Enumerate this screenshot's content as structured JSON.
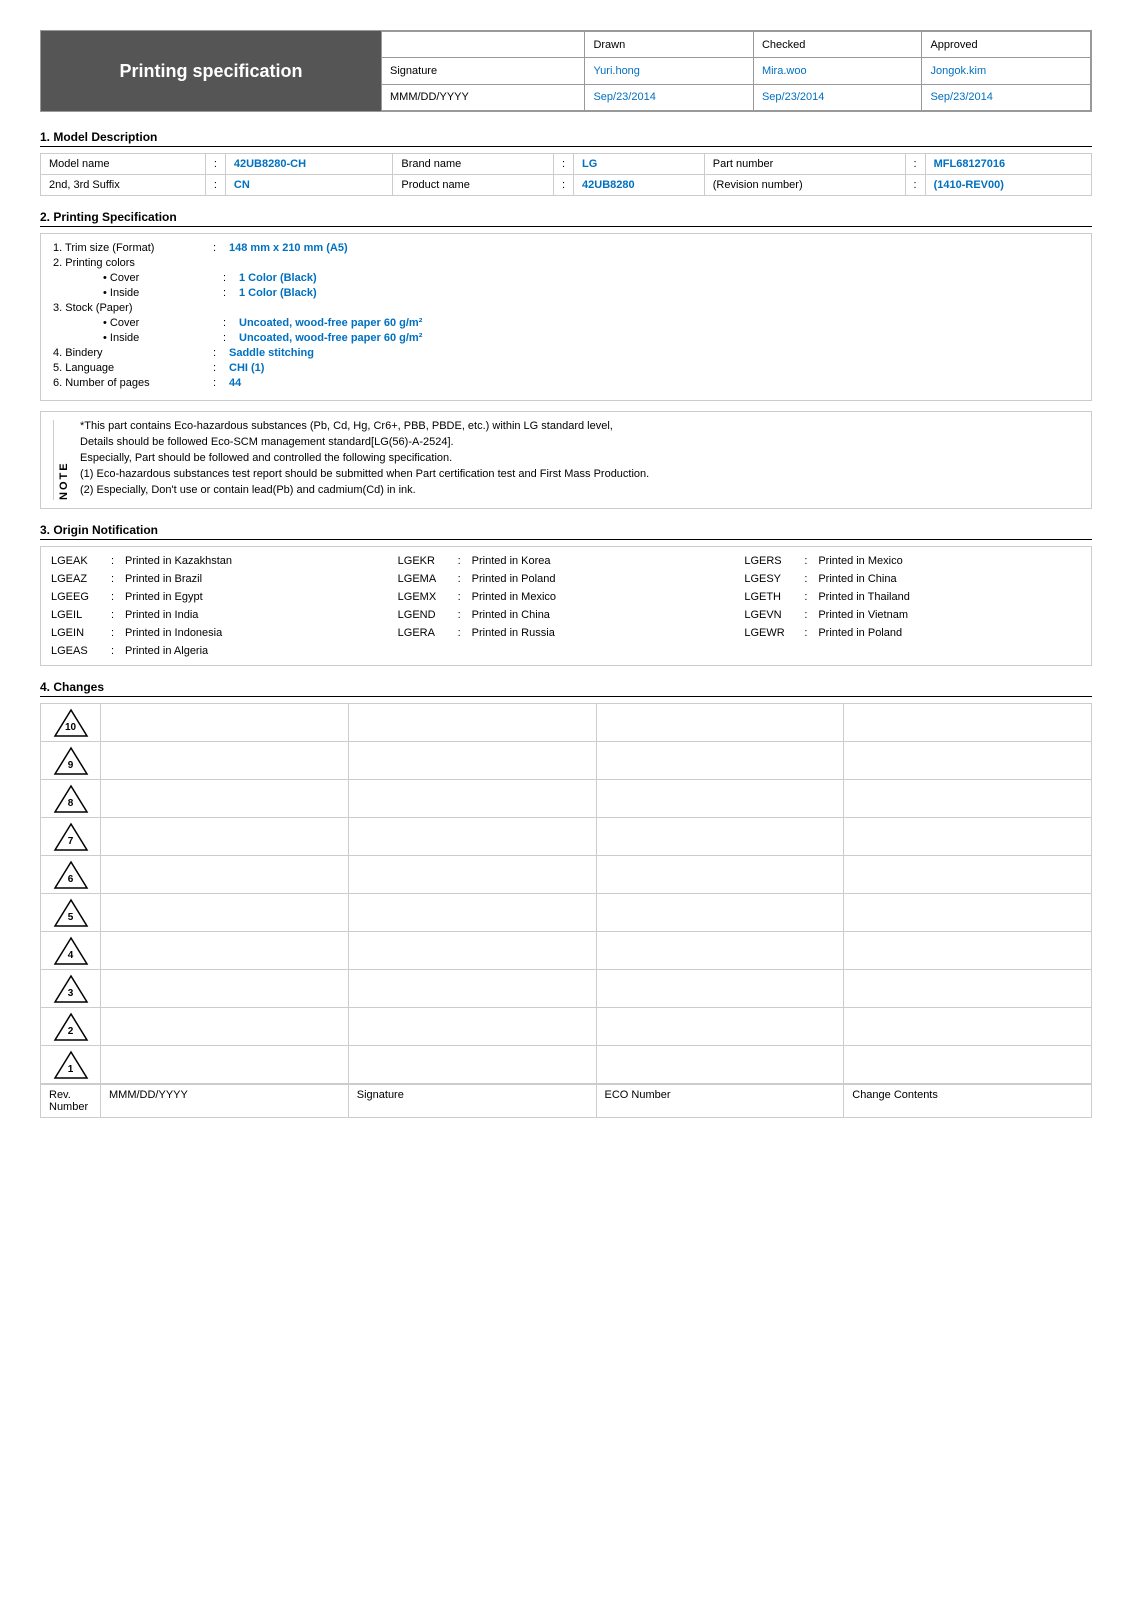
{
  "header": {
    "title": "Printing specification",
    "approval_cols": [
      "",
      "Drawn",
      "Checked",
      "Approved"
    ],
    "signature_label": "Signature",
    "date_label": "MMM/DD/YYYY",
    "drawn_name": "Yuri.hong",
    "checked_name": "Mira.woo",
    "approved_name": "Jongok.kim",
    "drawn_date": "Sep/23/2014",
    "checked_date": "Sep/23/2014",
    "approved_date": "Sep/23/2014"
  },
  "section1": {
    "title": "1. Model Description",
    "rows": [
      [
        {
          "label": "Model name",
          "colon": ":",
          "value": "42UB8280-CH"
        },
        {
          "label": "Brand name",
          "colon": ":",
          "value": "LG"
        },
        {
          "label": "Part number",
          "colon": ":",
          "value": "MFL68127016"
        }
      ],
      [
        {
          "label": "2nd, 3rd Suffix",
          "colon": ":",
          "value": "CN"
        },
        {
          "label": "Product name",
          "colon": ":",
          "value": "42UB8280"
        },
        {
          "label": "(Revision number)",
          "colon": ":",
          "value": "(1410-REV00)"
        }
      ]
    ]
  },
  "section2": {
    "title": "2. Printing Specification",
    "items": [
      {
        "num": "1.",
        "label": "Trim size (Format)",
        "colon": ":",
        "value": "148 mm x 210 mm (A5)"
      },
      {
        "num": "2.",
        "label": "Printing colors",
        "colon": "",
        "value": ""
      },
      {
        "num": "",
        "label": "• Cover",
        "colon": ":",
        "value": "1 Color (Black)",
        "sub": true
      },
      {
        "num": "",
        "label": "• Inside",
        "colon": ":",
        "value": "1 Color (Black)",
        "sub": true
      },
      {
        "num": "3.",
        "label": "Stock (Paper)",
        "colon": "",
        "value": ""
      },
      {
        "num": "",
        "label": "• Cover",
        "colon": ":",
        "value": "Uncoated, wood-free paper 60 g/m²",
        "sub": true
      },
      {
        "num": "",
        "label": "• Inside",
        "colon": ":",
        "value": "Uncoated, wood-free paper 60 g/m²",
        "sub": true
      },
      {
        "num": "4.",
        "label": "Bindery",
        "colon": ":",
        "value": "Saddle stitching"
      },
      {
        "num": "5.",
        "label": "Language",
        "colon": ":",
        "value": "CHI (1)"
      },
      {
        "num": "6.",
        "label": "Number of pages",
        "colon": ":",
        "value": "44"
      }
    ],
    "note": {
      "sidebar": "NOTE",
      "lines": [
        "*This part contains Eco-hazardous substances (Pb, Cd, Hg, Cr6+, PBB, PBDE, etc.) within LG standard level,",
        "Details should be followed Eco-SCM management standard[LG(56)-A-2524].",
        "Especially, Part should be followed and controlled the following specification.",
        "(1) Eco-hazardous substances test report should be submitted when Part certification test and First Mass Production.",
        "(2) Especially, Don't use or contain lead(Pb) and cadmium(Cd) in ink."
      ]
    }
  },
  "section3": {
    "title": "3. Origin Notification",
    "entries": [
      {
        "code": "LGEAK",
        "text": "Printed in Kazakhstan"
      },
      {
        "code": "LGEKR",
        "text": "Printed in Korea"
      },
      {
        "code": "LGERS",
        "text": "Printed in Mexico"
      },
      {
        "code": "LGEAZ",
        "text": "Printed in Brazil"
      },
      {
        "code": "LGEMA",
        "text": "Printed in Poland"
      },
      {
        "code": "LGESY",
        "text": "Printed in China"
      },
      {
        "code": "LGEEG",
        "text": "Printed in Egypt"
      },
      {
        "code": "LGEMX",
        "text": "Printed in Mexico"
      },
      {
        "code": "LGETH",
        "text": "Printed in Thailand"
      },
      {
        "code": "LGEIL",
        "text": "Printed in India"
      },
      {
        "code": "LGEND",
        "text": "Printed in China"
      },
      {
        "code": "LGEVN",
        "text": "Printed in Vietnam"
      },
      {
        "code": "LGEIN",
        "text": "Printed in Indonesia"
      },
      {
        "code": "LGERA",
        "text": "Printed in Russia"
      },
      {
        "code": "LGEWR",
        "text": "Printed in Poland"
      },
      {
        "code": "LGEAS",
        "text": "Printed in Algeria"
      },
      {
        "code": "",
        "text": ""
      },
      {
        "code": "",
        "text": ""
      }
    ]
  },
  "section4": {
    "title": "4. Changes",
    "rev_numbers": [
      "10",
      "9",
      "8",
      "7",
      "6",
      "5",
      "4",
      "3",
      "2",
      "1"
    ],
    "footer_labels": [
      "Rev. Number",
      "MMM/DD/YYYY",
      "Signature",
      "ECO Number",
      "Change Contents"
    ]
  }
}
